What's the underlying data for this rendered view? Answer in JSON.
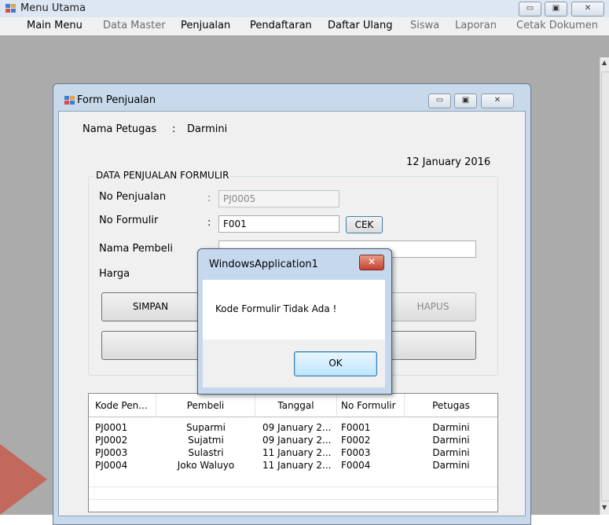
{
  "main_window": {
    "title": "Menu Utama",
    "caption_buttons": {
      "minimize": "▭",
      "maximize": "▣",
      "close": "✕"
    }
  },
  "menu": [
    {
      "label": "Main Menu",
      "enabled": true
    },
    {
      "label": "Data Master",
      "enabled": false
    },
    {
      "label": "Penjualan",
      "enabled": true
    },
    {
      "label": "Pendaftaran",
      "enabled": true
    },
    {
      "label": "Daftar Ulang",
      "enabled": true
    },
    {
      "label": "Siswa",
      "enabled": false
    },
    {
      "label": "Laporan",
      "enabled": false
    },
    {
      "label": "Cetak Dokumen",
      "enabled": false
    }
  ],
  "form": {
    "title": "Form Penjualan",
    "petugas_label": "Nama Petugas",
    "petugas_sep": ":",
    "petugas_value": "Darmini",
    "date": "12 January 2016",
    "group_title": "DATA PENJUALAN FORMULIR",
    "fields": {
      "no_penjualan": {
        "label": "No Penjualan",
        "sep": ":",
        "value": "PJ0005"
      },
      "no_formulir": {
        "label": "No Formulir",
        "sep": ":",
        "value": "F001"
      },
      "nama_pembeli": {
        "label": "Nama Pembeli",
        "value": ""
      },
      "harga": {
        "label": "Harga"
      }
    },
    "cek_label": "CEK",
    "simpan_label": "SIMPAN",
    "hapus_label": "HAPUS"
  },
  "grid": {
    "columns": [
      "Kode Pen...",
      "Pembeli",
      "Tanggal",
      "No Formulir",
      "Petugas"
    ],
    "rows": [
      [
        "PJ0001",
        "Suparmi",
        "09 January 2...",
        "F0001",
        "Darmini"
      ],
      [
        "PJ0002",
        "Sujatmi",
        "09 January 2...",
        "F0002",
        "Darmini"
      ],
      [
        "PJ0003",
        "Sulastri",
        "11 January 2...",
        "F0003",
        "Darmini"
      ],
      [
        "PJ0004",
        "Joko Waluyo",
        "11 January 2...",
        "F0004",
        "Darmini"
      ]
    ]
  },
  "dialog": {
    "title": "WindowsApplication1",
    "message": "Kode Formulir Tidak Ada !",
    "ok_label": "OK",
    "close_glyph": "✕"
  },
  "colors": {
    "menu_disabled": "#6d6d6d",
    "title_bar": "#dce7f3",
    "mdi_background": "#ababab"
  }
}
